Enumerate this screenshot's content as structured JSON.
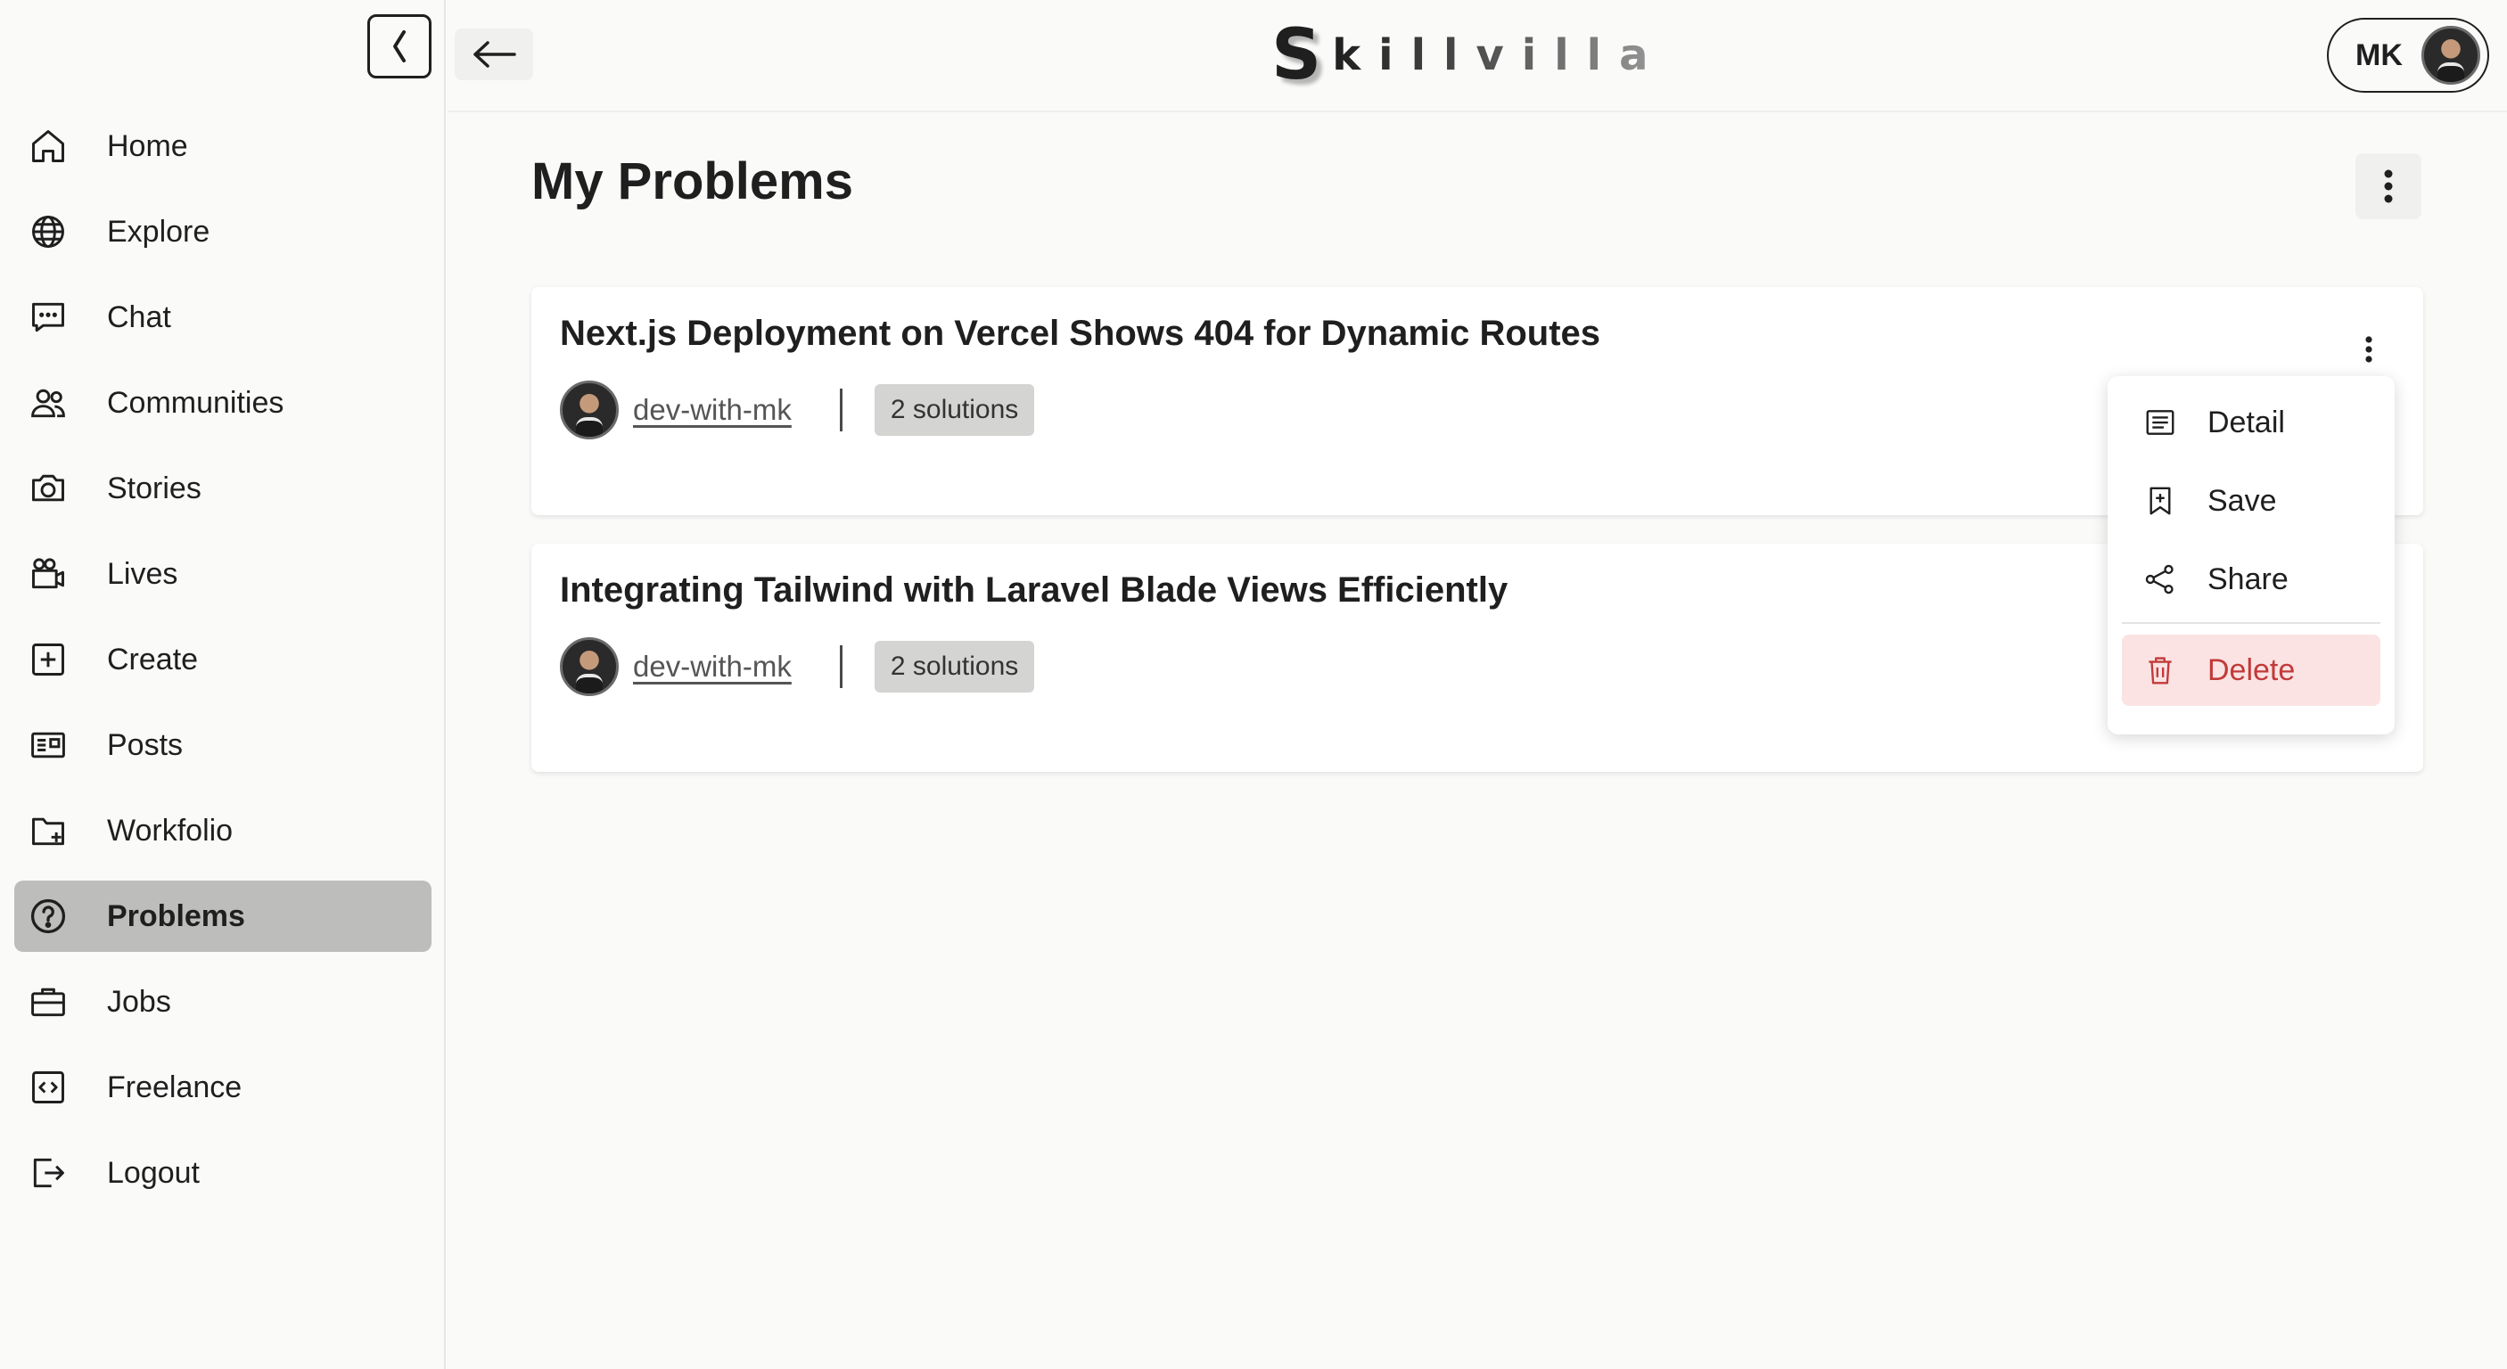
{
  "brand": {
    "logo_initial": "S",
    "logo_rest": "killvilla"
  },
  "user": {
    "initials": "MK"
  },
  "sidebar": {
    "items": [
      {
        "label": "Home",
        "icon": "home-icon"
      },
      {
        "label": "Explore",
        "icon": "globe-icon"
      },
      {
        "label": "Chat",
        "icon": "chat-icon"
      },
      {
        "label": "Communities",
        "icon": "users-icon"
      },
      {
        "label": "Stories",
        "icon": "camera-icon"
      },
      {
        "label": "Lives",
        "icon": "video-icon"
      },
      {
        "label": "Create",
        "icon": "plus-square-icon"
      },
      {
        "label": "Posts",
        "icon": "news-icon"
      },
      {
        "label": "Workfolio",
        "icon": "folder-plus-icon"
      },
      {
        "label": "Problems",
        "icon": "question-icon",
        "active": true
      },
      {
        "label": "Jobs",
        "icon": "briefcase-icon"
      },
      {
        "label": "Freelance",
        "icon": "code-icon"
      },
      {
        "label": "Logout",
        "icon": "logout-icon"
      }
    ]
  },
  "main": {
    "title": "My Problems",
    "problems": [
      {
        "title": "Next.js Deployment on Vercel Shows 404 for Dynamic Routes",
        "author": "dev-with-mk",
        "solutions": "2 solutions"
      },
      {
        "title": "Integrating Tailwind with Laravel Blade Views Efficiently",
        "author": "dev-with-mk",
        "solutions": "2 solutions"
      }
    ]
  },
  "context_menu": {
    "items": [
      {
        "label": "Detail",
        "icon": "detail-icon"
      },
      {
        "label": "Save",
        "icon": "bookmark-plus-icon"
      },
      {
        "label": "Share",
        "icon": "share-icon"
      },
      {
        "label": "Delete",
        "icon": "trash-icon",
        "danger": true
      }
    ]
  },
  "colors": {
    "active_nav": "#bdbdbb",
    "danger": "#c23a3a",
    "danger_bg": "#fbe3e3",
    "badge_bg": "#d4d4d2"
  }
}
